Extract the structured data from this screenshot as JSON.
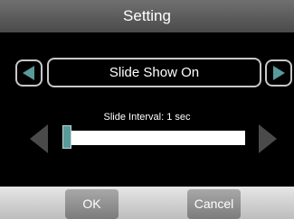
{
  "header": {
    "title": "Setting"
  },
  "mode_selector": {
    "value": "Slide Show On",
    "prev_icon": "left-triangle",
    "next_icon": "right-triangle"
  },
  "interval": {
    "label": "Slide Interval: 1 sec",
    "level": 0.0
  },
  "buttons": {
    "ok": "OK",
    "cancel": "Cancel"
  },
  "colors": {
    "accent": "#5a9a9a",
    "background": "#000000",
    "arrow_inactive": "#4a4a4a"
  }
}
